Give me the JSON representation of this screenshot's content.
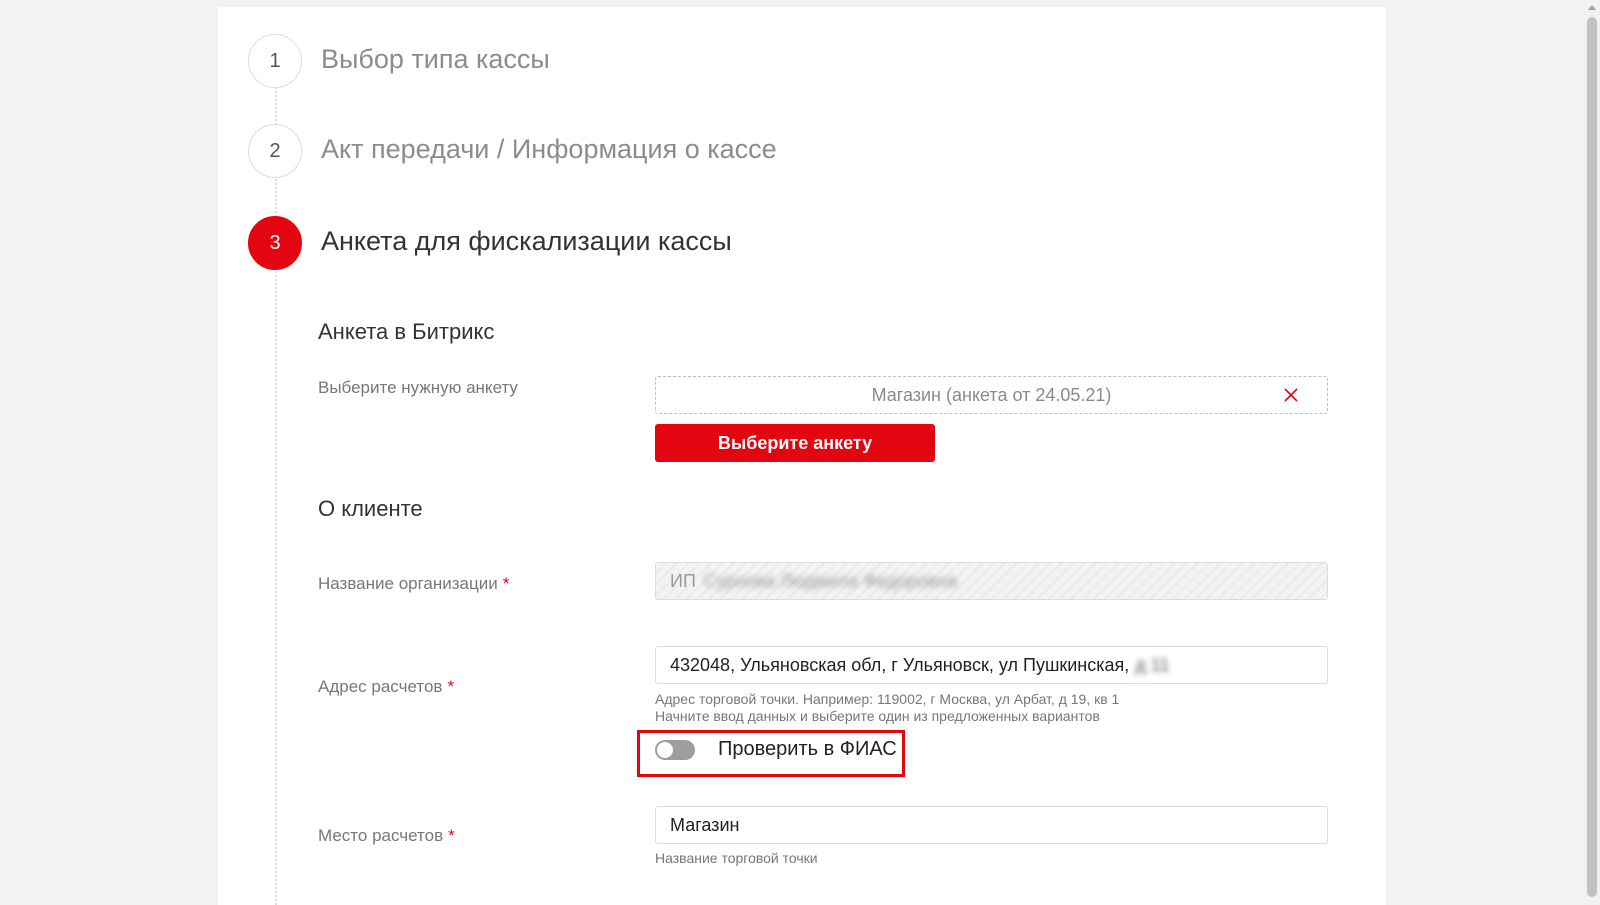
{
  "steps": [
    {
      "number": "1",
      "title": "Выбор типа кассы",
      "state": "done"
    },
    {
      "number": "2",
      "title": "Акт передачи / Информация о кассе",
      "state": "done"
    },
    {
      "number": "3",
      "title": "Анкета для фискализации кассы",
      "state": "active"
    }
  ],
  "bitrix": {
    "section_title": "Анкета в Битрикс",
    "select_label": "Выберите нужную анкету",
    "selected_value": "Магазин (анкета от 24.05.21)",
    "choose_button": "Выберите анкету"
  },
  "client": {
    "section_title": "О клиенте",
    "org_label": "Название организации",
    "org_prefix": "ИП",
    "org_name_hidden": "Сурнова Людмила Федоровна",
    "address_label": "Адрес расчетов",
    "address_value": "432048, Ульяновская обл, г Ульяновск, ул Пушкинская,",
    "address_hidden_tail": "д 11",
    "address_hint_1": "Адрес торговой точки. Например: 119002, г Москва, ул Арбат, д 19, кв 1",
    "address_hint_2": "Начните ввод данных и выберите один из предложенных вариантов",
    "fias_label": "Проверить в ФИАС",
    "fias_enabled": false,
    "place_label": "Место расчетов",
    "place_value": "Магазин",
    "place_hint": "Название торговой точки",
    "required_mark": "*"
  },
  "colors": {
    "accent": "#e30611",
    "muted_text": "#8c8c8c",
    "background": "#f2f2f2"
  }
}
